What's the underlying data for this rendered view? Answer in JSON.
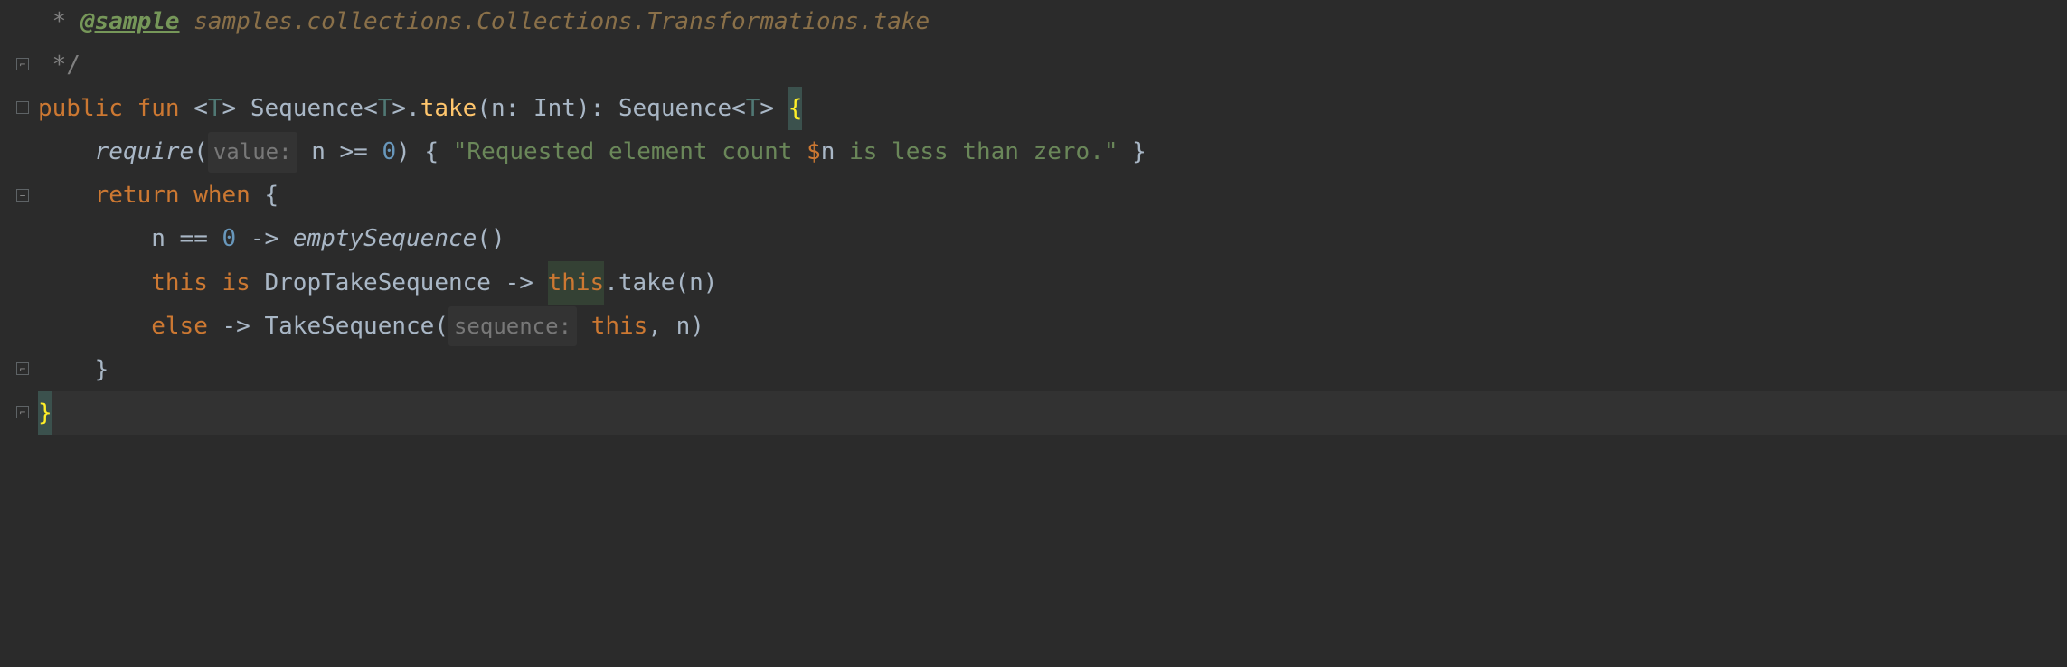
{
  "code": {
    "doc_star": " * ",
    "doc_tag": "@sample",
    "doc_text": " samples.collections.Collections.Transformations.take",
    "doc_end": " */",
    "l3": {
      "public": "public",
      "fun": "fun",
      "lt1": " <",
      "tp1": "T",
      "gt1": "> ",
      "seq1": "Sequence",
      "lt2": "<",
      "tp2": "T",
      "gt2": ">",
      "dot": ".",
      "take": "take",
      "lparen": "(",
      "n": "n",
      "colon": ": ",
      "int": "Int",
      "rparen": ")",
      "retcolon": ": ",
      "seq2": "Sequence",
      "lt3": "<",
      "tp3": "T",
      "gt3": "> ",
      "lbrace": "{"
    },
    "l4": {
      "indent": "    ",
      "require": "require",
      "lparen": "(",
      "hint": "value:",
      "sp": " ",
      "n": "n",
      "op": " >= ",
      "zero": "0",
      "rparen": ") ",
      "lbrace": "{ ",
      "str1": "\"Requested element count ",
      "dollar": "$",
      "var": "n",
      "str2": " is less than zero.\"",
      "rbrace": " }"
    },
    "l5": {
      "indent": "    ",
      "return": "return",
      "sp": " ",
      "when": "when",
      "sp2": " ",
      "lbrace": "{"
    },
    "l6": {
      "indent": "        ",
      "n": "n",
      "eq": " == ",
      "zero": "0",
      "arrow": " -> ",
      "empty": "emptySequence",
      "parens": "()"
    },
    "l7": {
      "indent": "        ",
      "this1": "this",
      "sp1": " ",
      "is": "is",
      "sp2": " ",
      "type": "DropTakeSequence",
      "arrow": " -> ",
      "this2": "this",
      "dot": ".",
      "take": "take",
      "lparen": "(",
      "n": "n",
      "rparen": ")"
    },
    "l8": {
      "indent": "        ",
      "else": "else",
      "arrow": " -> ",
      "type": "TakeSequence",
      "lparen": "(",
      "hint": "sequence:",
      "sp": " ",
      "this": "this",
      "comma": ", ",
      "n": "n",
      "rparen": ")"
    },
    "l9": {
      "indent": "    ",
      "rbrace": "}"
    },
    "l10": {
      "rbrace": "}"
    }
  },
  "fold": {
    "minus": "−",
    "end": "⌐"
  }
}
